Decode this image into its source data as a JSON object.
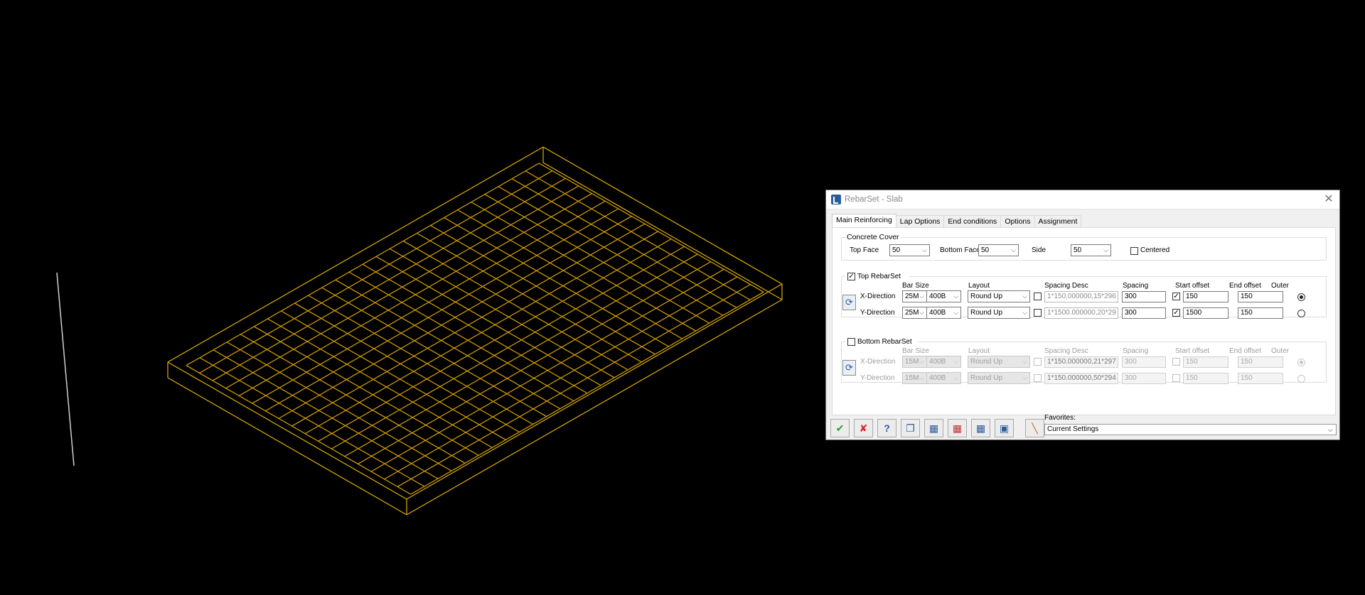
{
  "window": {
    "title": "RebarSet - Slab"
  },
  "tabs": [
    "Main Reinforcing",
    "Lap Options",
    "End conditions",
    "Options",
    "Assignment"
  ],
  "concrete_cover": {
    "title": "Concrete Cover",
    "top_face_label": "Top Face",
    "top_face_value": "50",
    "bottom_face_label": "Bottom Face",
    "bottom_face_value": "50",
    "side_label": "Side",
    "side_value": "50",
    "centered_label": "Centered"
  },
  "columns": {
    "bar_size": "Bar Size",
    "layout": "Layout",
    "spacing_desc": "Spacing Desc",
    "spacing": "Spacing",
    "start_offset": "Start offset",
    "end_offset": "End offset",
    "outer": "Outer"
  },
  "top_rebarset": {
    "title": "Top RebarSet",
    "x": {
      "label": "X-Direction",
      "size": "25M",
      "grade": "400B",
      "layout": "Round Up",
      "desc": "1*150.000000,15*296",
      "spacing": "300",
      "start": "150",
      "end": "150"
    },
    "y": {
      "label": "Y-Direction",
      "size": "25M",
      "grade": "400B",
      "layout": "Round Up",
      "desc": "1*1500.000000,20*29",
      "spacing": "300",
      "start": "1500",
      "end": "150"
    }
  },
  "bottom_rebarset": {
    "title": "Bottom RebarSet",
    "x": {
      "label": "X-Direction",
      "size": "15M",
      "grade": "400B",
      "layout": "Round Up",
      "desc": "1*150.000000,21*297",
      "spacing": "300",
      "start": "150",
      "end": "150"
    },
    "y": {
      "label": "Y-Direction",
      "size": "15M",
      "grade": "400B",
      "layout": "Round Up",
      "desc": "1*150.000000,50*294",
      "spacing": "300",
      "start": "150",
      "end": "150"
    }
  },
  "favorites": {
    "label": "Favorites:",
    "value": "Current Settings"
  },
  "colors": {
    "rebar": "#d9a400",
    "slab_edge": "#e0b000",
    "background": "#000000"
  }
}
